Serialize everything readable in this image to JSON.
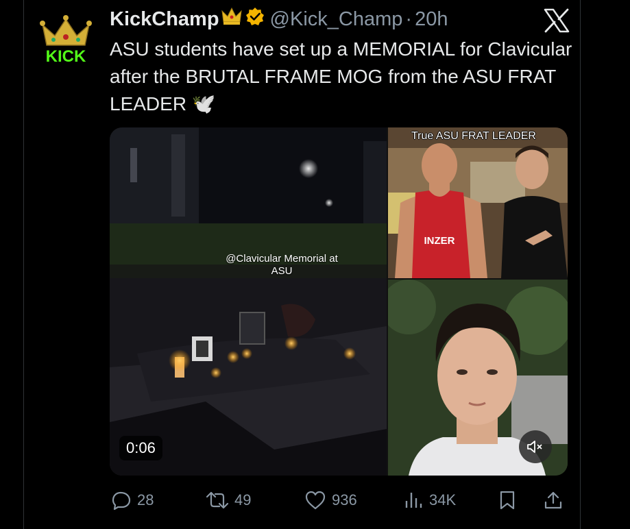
{
  "tweet": {
    "author_name": "KickChamp",
    "author_handle": "@Kick_Champ",
    "separator": "·",
    "time_ago": "20h",
    "text": "ASU students have set up a MEMORIAL for Clavicular after the BRUTAL FRAME MOG from the ASU FRAT LEADER 🕊️",
    "avatar_text": "KICK",
    "avatar_text_color": "#53fc18",
    "crown_color": "#d4af37"
  },
  "media": {
    "video_overlay_text_1": "@Clavicular Memorial at",
    "video_overlay_text_2": "ASU",
    "frat_label": "True ASU FRAT LEADER",
    "shirt_text": "INZER",
    "timestamp": "0:06",
    "mute_icon": "speaker-muted-icon"
  },
  "actions": {
    "replies": "28",
    "reposts": "49",
    "likes": "936",
    "views": "34K"
  },
  "colors": {
    "background": "#000000",
    "text": "#e7e9ea",
    "muted": "#8b98a5",
    "verified": "#f4b400"
  }
}
